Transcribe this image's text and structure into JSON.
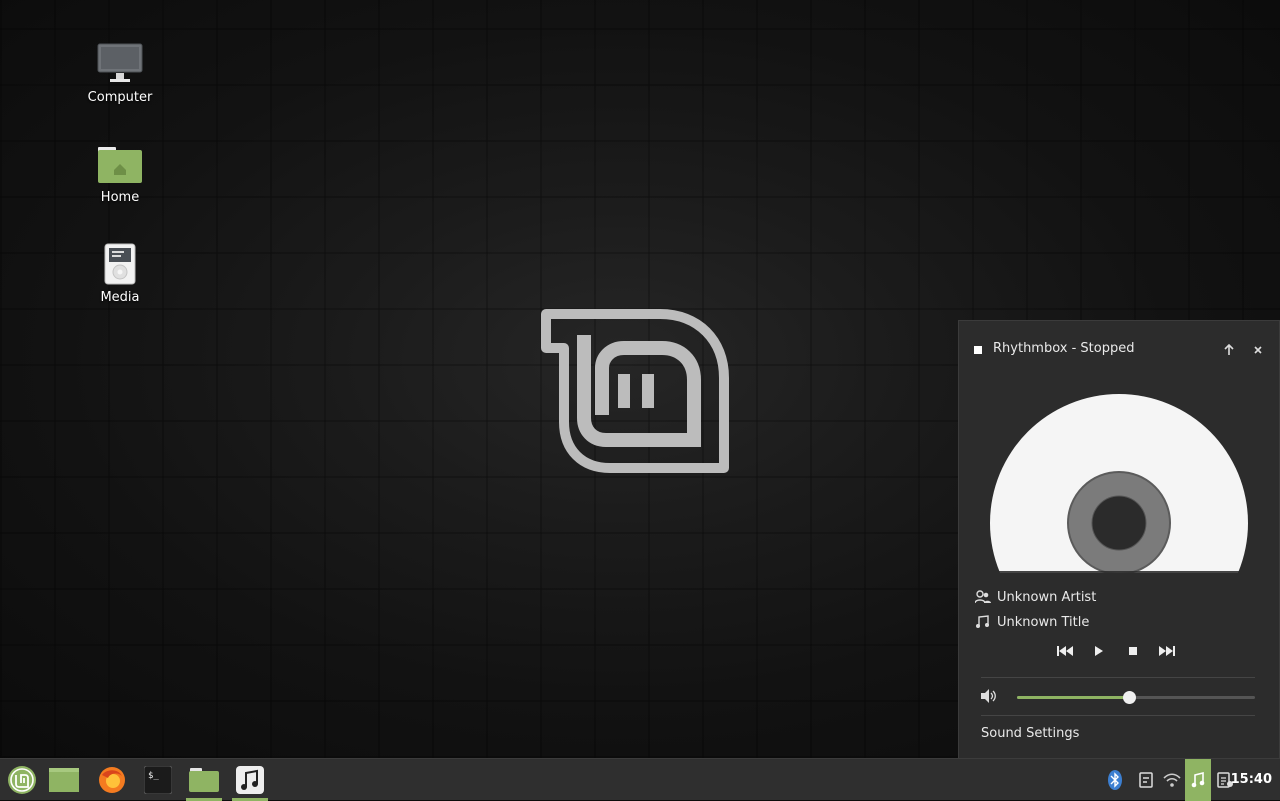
{
  "desktop": {
    "icons": [
      {
        "label": "Computer",
        "icon": "computer-icon"
      },
      {
        "label": "Home",
        "icon": "home-folder-icon"
      },
      {
        "label": "Media",
        "icon": "media-player-icon"
      }
    ]
  },
  "player": {
    "title": "Rhythmbox - Stopped",
    "artist": "Unknown Artist",
    "track_title": "Unknown Title",
    "volume_percent": 47,
    "sound_settings_label": "Sound Settings",
    "buttons": [
      "previous-icon",
      "play-icon",
      "stop-icon",
      "next-icon"
    ]
  },
  "panel": {
    "launchers": [
      "mint-menu-icon",
      "show-desktop-icon",
      "firefox-icon",
      "terminal-icon",
      "files-icon",
      "rhythmbox-icon"
    ],
    "tray": [
      "bluetooth-icon",
      "notes-icon",
      "wifi-icon",
      "sound-applet-icon",
      "updates-icon"
    ],
    "clock": "15:40"
  },
  "colors": {
    "accent": "#8fb463",
    "panel_bg": "#2f2f2f",
    "popup_bg": "#2c2c2c"
  }
}
